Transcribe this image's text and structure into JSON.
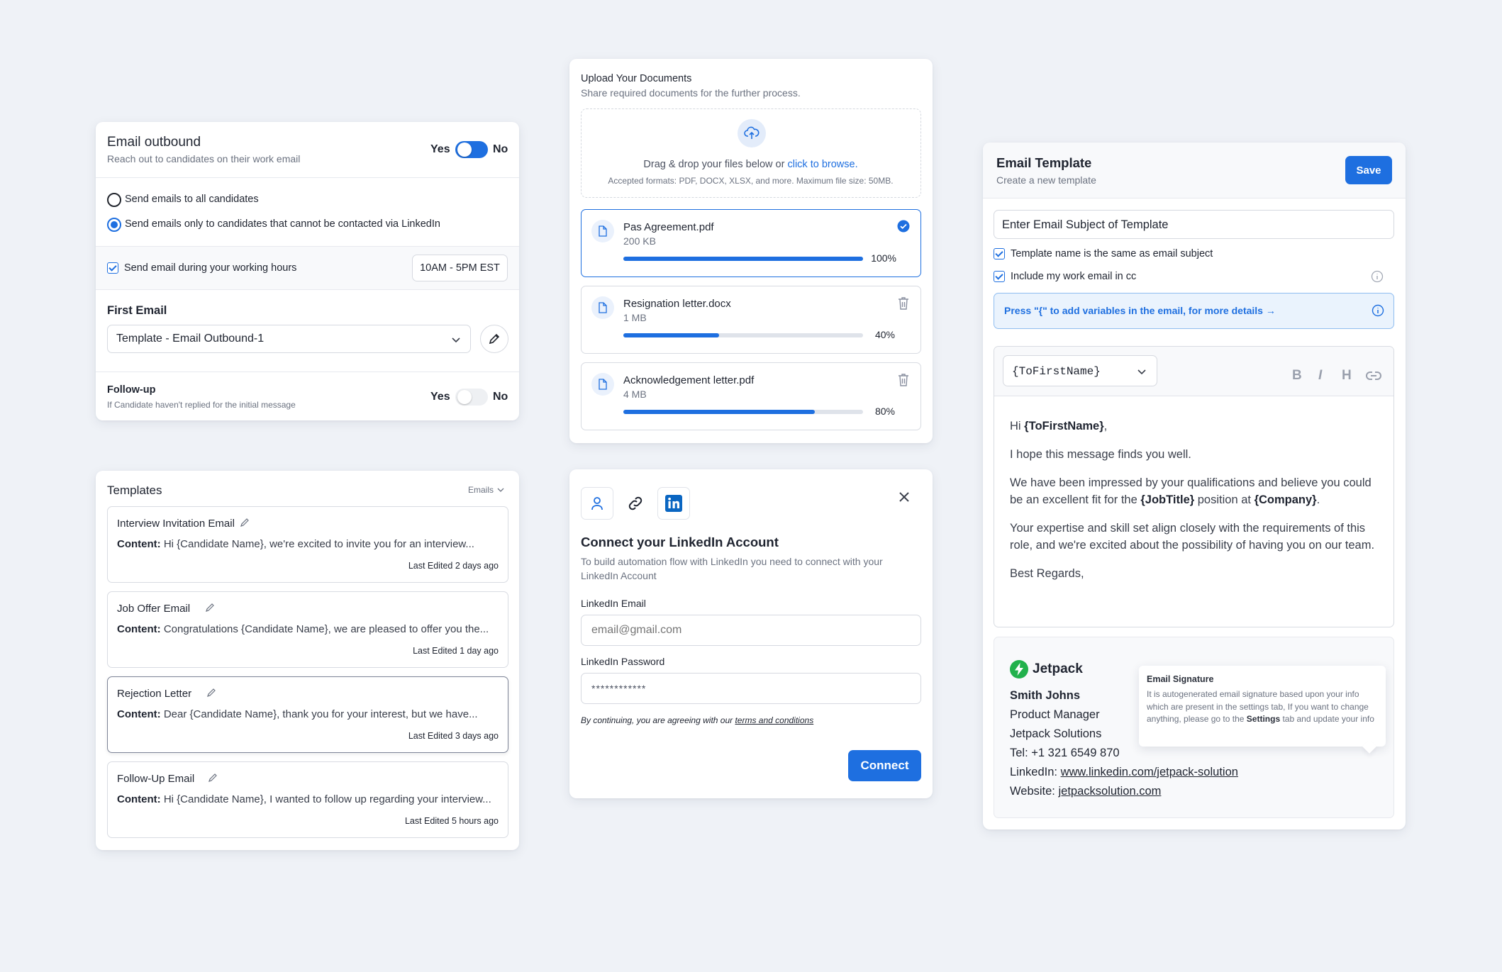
{
  "email_outbound": {
    "title": "Email outbound",
    "subtitle": "Reach out to candidates on their work email",
    "toggle_yes": "Yes",
    "toggle_no": "No",
    "toggle_on": true,
    "radio_all": "Send emails to all candidates",
    "radio_linkedin": "Send emails only to candidates that cannot be contacted via LinkedIn",
    "working_hours_label": "Send email during your working hours",
    "working_hours_value": "10AM - 5PM EST",
    "first_email_label": "First Email",
    "first_email_value": "Template - Email Outbound-1",
    "followup_title": "Follow-up",
    "followup_subtitle": "If Candidate haven't replied for the initial message",
    "followup_yes": "Yes",
    "followup_no": "No",
    "followup_on": false
  },
  "templates": {
    "title": "Templates",
    "filter": "Emails",
    "items": [
      {
        "name": "Interview Invitation Email",
        "content_label": "Content:",
        "content": "Hi {Candidate Name}, we're excited to invite you for an interview...",
        "meta": "Last Edited 2 days ago"
      },
      {
        "name": "Job Offer Email",
        "content_label": "Content:",
        "content": "Congratulations {Candidate Name}, we are pleased to offer you the...",
        "meta": "Last Edited 1 day ago"
      },
      {
        "name": "Rejection Letter",
        "content_label": "Content:",
        "content": "Dear {Candidate Name}, thank you for your interest, but we have...",
        "meta": "Last Edited 3 days ago"
      },
      {
        "name": "Follow-Up Email",
        "content_label": "Content:",
        "content": "Hi {Candidate Name}, I wanted to follow up regarding your interview...",
        "meta": "Last Edited 5 hours ago"
      }
    ]
  },
  "upload": {
    "title": "Upload Your Documents",
    "subtitle": "Share required documents for the further process.",
    "drop_text": "Drag & drop your files below or ",
    "browse_link": "click to browse.",
    "formats": "Accepted formats: PDF, DOCX, XLSX, and more. Maximum file size: 50MB.",
    "files": [
      {
        "name": "Pas Agreement.pdf",
        "size": "200 KB",
        "progress": 100,
        "progress_label": "100%",
        "status": "complete"
      },
      {
        "name": "Resignation letter.docx",
        "size": "1 MB",
        "progress": 40,
        "progress_label": "40%",
        "status": "uploading"
      },
      {
        "name": "Acknowledgement letter.pdf",
        "size": "4 MB",
        "progress": 80,
        "progress_label": "80%",
        "status": "uploading"
      }
    ]
  },
  "linkedin": {
    "title": "Connect your LinkedIn Account",
    "description": "To build automation flow with LinkedIn you need to connect with your LinkedIn Account",
    "email_label": "LinkedIn Email",
    "email_placeholder": "email@gmail.com",
    "password_label": "LinkedIn Password",
    "password_value": "************",
    "terms_prefix": "By continuing, you are agreeing with our ",
    "terms_link": "terms and conditions",
    "connect_button": "Connect",
    "icons": [
      "user-icon",
      "link-icon",
      "linkedin-icon"
    ]
  },
  "email_template": {
    "title": "Email Template",
    "subtitle": "Create a new template",
    "save_button": "Save",
    "subject_value": "Enter Email Subject of Template",
    "check_same_subject": "Template name is the same as email subject",
    "check_cc": "Include my work email in cc",
    "variables_hint": "Press \"{\" to add variables in the email, for more details →",
    "variable_select": "{ToFirstName}",
    "toolbar": {
      "bold": "B",
      "italic": "I",
      "heading": "H"
    },
    "body": {
      "greeting_prefix": "Hi ",
      "greeting_var": "{ToFirstName}",
      "greeting_suffix": ",",
      "p1": "I hope this message finds you well.",
      "p2_a": "We have been impressed by your qualifications and believe you could be an excellent fit for the ",
      "p2_var1": "{JobTitle}",
      "p2_b": " position at ",
      "p2_var2": "{Company}",
      "p2_c": ".",
      "p3": "Your expertise and skill set align closely with the requirements of this role, and we're excited about the possibility of having you on our team.",
      "p4": "Best Regards,"
    },
    "signature": {
      "brand": "Jetpack",
      "name": "Smith Johns",
      "role": "Product Manager",
      "company": "Jetpack Solutions",
      "tel": "Tel: +1 321 6549 870",
      "linkedin_label": "LinkedIn: ",
      "linkedin_url": "www.linkedin.com/jetpack-solution",
      "website_label": "Website: ",
      "website_url": "jetpacksolution.com",
      "tooltip_title": "Email Signature",
      "tooltip_text_a": "It is autogenerated email signature based upon your info which are present in the settings tab, If you want to change anything, please go to the ",
      "tooltip_bold": "Settings",
      "tooltip_text_b": " tab and update your info"
    },
    "colors": {
      "accent": "#1e6fe0",
      "brand_green": "#22b14c",
      "hint_bg": "#eaf3fd"
    }
  }
}
